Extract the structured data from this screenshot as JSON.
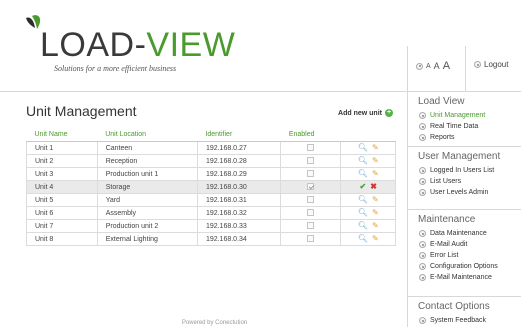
{
  "brand": {
    "name_part1": "LOAD-",
    "name_part2": "VIEW",
    "tagline": "Solutions for a more efficient business"
  },
  "header": {
    "font_size": [
      "A",
      "A",
      "A"
    ],
    "logout_label": "Logout"
  },
  "page": {
    "title": "Unit Management",
    "add_unit_label": "Add new unit",
    "footer": "Powered by Conectution"
  },
  "table": {
    "columns": [
      "Unit Name",
      "Unit Location",
      "Identifier",
      "Enabled"
    ],
    "rows": [
      {
        "name": "Unit 1",
        "location": "Canteen",
        "id": "192.168.0.27",
        "enabled": false
      },
      {
        "name": "Unit 2",
        "location": "Reception",
        "id": "192.168.0.28",
        "enabled": false
      },
      {
        "name": "Unit 3",
        "location": "Production unit 1",
        "id": "192.168.0.29",
        "enabled": false
      },
      {
        "name": "Unit 4",
        "location": "Storage",
        "id": "192.168.0.30",
        "enabled": true
      },
      {
        "name": "Unit 5",
        "location": "Yard",
        "id": "192.168.0.31",
        "enabled": false
      },
      {
        "name": "Unit 6",
        "location": "Assembly",
        "id": "192.168.0.32",
        "enabled": false
      },
      {
        "name": "Unit 7",
        "location": "Production unit 2",
        "id": "192.168.0.33",
        "enabled": false
      },
      {
        "name": "Unit 8",
        "location": "External Lighting",
        "id": "192.168.0.34",
        "enabled": false
      }
    ]
  },
  "sidebar": {
    "sections": [
      {
        "title": "Load View",
        "items": [
          "Unit Management",
          "Real Time Data",
          "Reports"
        ]
      },
      {
        "title": "User Management",
        "items": [
          "Logged In Users List",
          "List Users",
          "User Levels Admin"
        ]
      },
      {
        "title": "Maintenance",
        "items": [
          "Data Maintenance",
          "E-Mail Audit",
          "Error List",
          "Configuration Options",
          "E-Mail Maintenance"
        ]
      },
      {
        "title": "Contact Options",
        "items": [
          "System Feedback"
        ]
      }
    ]
  },
  "colors": {
    "accent": "#4a9a2e",
    "add_icon": "#56b14a",
    "edit_icon": "#e0a030",
    "search_icon": "#6aa0c8"
  }
}
